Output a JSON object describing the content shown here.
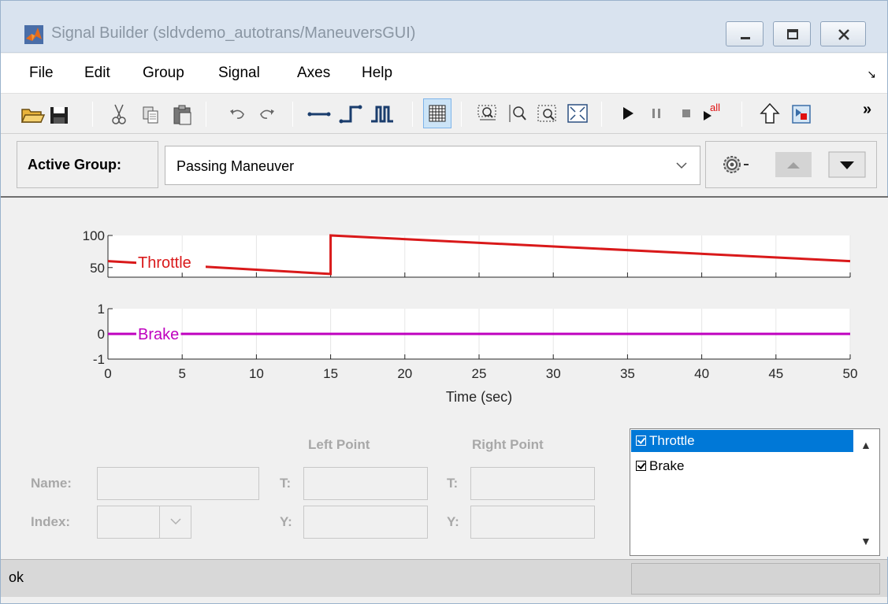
{
  "window": {
    "title": "Signal Builder (sldvdemo_autotrans/ManeuversGUI)"
  },
  "menu": {
    "items": [
      "File",
      "Edit",
      "Group",
      "Signal",
      "Axes",
      "Help"
    ]
  },
  "toolbar": {
    "more_label": "»"
  },
  "active_group": {
    "label": "Active Group:",
    "value": "Passing Maneuver"
  },
  "chart_data": [
    {
      "type": "line",
      "ylim": [
        35,
        100
      ],
      "yticks": [
        50,
        100
      ],
      "series": [
        {
          "name": "Throttle",
          "color": "#d9191a",
          "x": [
            0,
            15,
            15,
            50
          ],
          "y": [
            60,
            40,
            100,
            60
          ]
        }
      ]
    },
    {
      "type": "line",
      "ylim": [
        -1,
        1
      ],
      "yticks": [
        -1,
        0,
        1
      ],
      "xlim": [
        0,
        50
      ],
      "xticks": [
        0,
        5,
        10,
        15,
        20,
        25,
        30,
        35,
        40,
        45,
        50
      ],
      "xlabel": "Time (sec)",
      "series": [
        {
          "name": "Brake",
          "color": "#bf00bf",
          "x": [
            0,
            50
          ],
          "y": [
            0,
            0
          ]
        }
      ]
    }
  ],
  "point_editor": {
    "left_point_label": "Left Point",
    "right_point_label": "Right Point",
    "name_label": "Name:",
    "index_label": "Index:",
    "t_label": "T:",
    "y_label": "Y:"
  },
  "signals": {
    "items": [
      {
        "label": "Throttle",
        "checked": true,
        "selected": true
      },
      {
        "label": "Brake",
        "checked": true,
        "selected": false
      }
    ]
  },
  "status": {
    "text": "ok"
  },
  "colors": {
    "accent": "#0078d7",
    "throttle": "#d9191a",
    "brake": "#bf00bf"
  }
}
